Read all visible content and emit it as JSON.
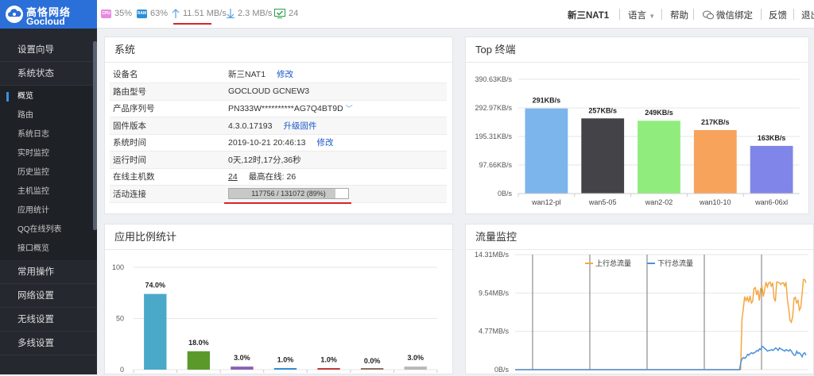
{
  "brand": {
    "title_cn": "高恪网络",
    "title_en": "Gocloud"
  },
  "status": {
    "cpu_icon": "CPU",
    "cpu": "35%",
    "ram_icon": "RAM",
    "ram": "63%",
    "upload": "11.51 MB/s",
    "download": "2.3 MB/s",
    "connections": "24"
  },
  "header": {
    "device": "新三NAT1",
    "language": "语言",
    "help": "帮助",
    "wechat": "微信绑定",
    "feedback": "反馈",
    "exit": "退出"
  },
  "sidebar": {
    "top_items": [
      "设置向导",
      "系统状态"
    ],
    "sub_items": [
      "概览",
      "路由",
      "系统日志",
      "实时监控",
      "历史监控",
      "主机监控",
      "应用统计",
      "QQ在线列表",
      "接口概览"
    ],
    "bottom_items": [
      "常用操作",
      "网络设置",
      "无线设置",
      "多线设置"
    ]
  },
  "system": {
    "title": "系统",
    "rows": [
      {
        "key": "设备名",
        "value": "新三NAT1",
        "link": "修改"
      },
      {
        "key": "路由型号",
        "value": "GOCLOUD GCNEW3"
      },
      {
        "key": "产品序列号",
        "value": "PN333W**********AG7Q4BT9D"
      },
      {
        "key": "固件版本",
        "value": "4.3.0.17193",
        "link": "升级固件"
      },
      {
        "key": "系统时间",
        "value": "2019-10-21 20:46:13",
        "link": "修改"
      },
      {
        "key": "运行时间",
        "value": "0天,12时,17分,36秒"
      },
      {
        "key": "在线主机数",
        "value": "24",
        "extra": "最高在线: 26"
      }
    ],
    "active_conn_key": "活动连接",
    "active_conn_text": "117756 / 131072 (89%)",
    "active_conn_fraction": 0.89
  },
  "top": {
    "title": "Top 终端",
    "chart_data": {
      "type": "bar",
      "categories": [
        "wan12-pl",
        "wan5-05",
        "wan2-02",
        "wan10-10",
        "wan6-06xl"
      ],
      "values": [
        291,
        257,
        249,
        217,
        163
      ],
      "value_labels": [
        "291KB/s",
        "257KB/s",
        "249KB/s",
        "217KB/s",
        "163KB/s"
      ],
      "colors": [
        "#7cb5ec",
        "#434348",
        "#90ed7d",
        "#f7a35c",
        "#8085e9"
      ],
      "ylim": [
        0,
        390.63
      ],
      "yticks": [
        0,
        97.66,
        195.31,
        292.97,
        390.63
      ],
      "ytick_labels": [
        "0B/s",
        "97.66KB/s",
        "195.31KB/s",
        "292.97KB/s",
        "390.63KB/s"
      ],
      "grid": true
    }
  },
  "app": {
    "title": "应用比例统计",
    "chart_data": {
      "type": "bar",
      "values": [
        74.0,
        18.0,
        3.0,
        1.0,
        1.0,
        0.0,
        3.0
      ],
      "value_labels": [
        "74.0%",
        "18.0%",
        "3.0%",
        "1.0%",
        "1.0%",
        "0.0%",
        "3.0%"
      ],
      "colors": [
        "#4aa9c9",
        "#5b9a2a",
        "#8a5fb3",
        "#2f8fd6",
        "#c23a3a",
        "#8d6e63",
        "#b8b8b8"
      ],
      "ylim": [
        0,
        100
      ],
      "yticks": [
        0,
        50,
        100
      ],
      "grid": true
    }
  },
  "traffic": {
    "title": "流量监控",
    "chart_data": {
      "type": "line",
      "series": [
        {
          "name": "上行总流量",
          "color": "#f5a742",
          "values": [
            0,
            0,
            0,
            0,
            0,
            0,
            0,
            0,
            0,
            0,
            0,
            0,
            0,
            0,
            0,
            0,
            0,
            0,
            0,
            0,
            0,
            0,
            0,
            0,
            0,
            0,
            0,
            0,
            0,
            0,
            0,
            0,
            0,
            0,
            0,
            0,
            0,
            0,
            0,
            0,
            0,
            0,
            0,
            0,
            0,
            0,
            0,
            0,
            0,
            0,
            0,
            0,
            0,
            0,
            0,
            0,
            0,
            0,
            0,
            0,
            0,
            0,
            0,
            0,
            0,
            0,
            0,
            0,
            0,
            0,
            0,
            0,
            0,
            0,
            0,
            0,
            0,
            0,
            0,
            0,
            0,
            0,
            0,
            0,
            0,
            0,
            0,
            0,
            0,
            0,
            0,
            0,
            0,
            0,
            0,
            0,
            0,
            0,
            0,
            0,
            0,
            0,
            0,
            0,
            0,
            0,
            0,
            0,
            0,
            0,
            0,
            0,
            0,
            0,
            0,
            0,
            0,
            0,
            0,
            0,
            0,
            0,
            0,
            0,
            0,
            0,
            0,
            0,
            0,
            0,
            0,
            0,
            0,
            0,
            0,
            0,
            0,
            0,
            0,
            0,
            0,
            0,
            0,
            0,
            0,
            0,
            0,
            0,
            0,
            0,
            0,
            0,
            0,
            0,
            0,
            0,
            0,
            0,
            0,
            0,
            0,
            0,
            0,
            0,
            0,
            0,
            0,
            0,
            0,
            0,
            6.3,
            7.6,
            9.1,
            8.6,
            9.0,
            8.4,
            9.2,
            8.3,
            8.5,
            10.1,
            10.2,
            9.3,
            9.9,
            8.6,
            10.1,
            10.3,
            9.1,
            10.0,
            10.9,
            10.3,
            10.8,
            10.9,
            10.4,
            10.8,
            8.9,
            8.5,
            10.9,
            10.9,
            10.8,
            10.6,
            10.8,
            10.8,
            10.4,
            10.9,
            8.8,
            7.6,
            6.1,
            5.9,
            6.6,
            8.9,
            9.0,
            8.3,
            8.6,
            7.4,
            7.7,
            9.4,
            11.2,
            11.2,
            10.8
          ]
        },
        {
          "name": "下行总流量",
          "color": "#4a90d9",
          "values": [
            0,
            0,
            0,
            0,
            0,
            0,
            0,
            0,
            0,
            0,
            0,
            0,
            0,
            0,
            0,
            0,
            0,
            0,
            0,
            0,
            0,
            0,
            0,
            0,
            0,
            0,
            0,
            0,
            0,
            0,
            0,
            0,
            0,
            0,
            0,
            0,
            0,
            0,
            0,
            0,
            0,
            0,
            0,
            0,
            0,
            0,
            0,
            0,
            0,
            0,
            0,
            0,
            0,
            0,
            0,
            0,
            0,
            0,
            0,
            0,
            0,
            0,
            0,
            0,
            0,
            0,
            0,
            0,
            0,
            0,
            0,
            0,
            0,
            0,
            0,
            0,
            0,
            0,
            0,
            0,
            0,
            0,
            0,
            0,
            0,
            0,
            0,
            0,
            0,
            0,
            0,
            0,
            0,
            0,
            0,
            0,
            0,
            0,
            0,
            0,
            0,
            0,
            0,
            0,
            0,
            0,
            0,
            0,
            0,
            0,
            0,
            0,
            0,
            0,
            0,
            0,
            0,
            0,
            0,
            0,
            0,
            0,
            0,
            0,
            0,
            0,
            0,
            0,
            0,
            0,
            0,
            0,
            0,
            0,
            0,
            0,
            0,
            0,
            0,
            0,
            0,
            0,
            0,
            0,
            0,
            0,
            0,
            0,
            0,
            0,
            0,
            0,
            0,
            0,
            0,
            0,
            0,
            0,
            0,
            0,
            0,
            0,
            0,
            0,
            0,
            0,
            0,
            0,
            0,
            0,
            1.0,
            1.4,
            1.5,
            1.4,
            1.6,
            1.9,
            1.8,
            2.0,
            2.1,
            2.0,
            2.1,
            2.2,
            2.4,
            2.3,
            2.6,
            2.5,
            2.9,
            2.8,
            2.6,
            2.5,
            2.3,
            2.4,
            2.4,
            2.5,
            2.4,
            2.5,
            2.7,
            2.6,
            2.4,
            2.7,
            2.6,
            2.5,
            2.4,
            2.3,
            2.5,
            2.4,
            2.3,
            2.5,
            2.3,
            2.0,
            1.8,
            1.8,
            2.3,
            2.0,
            2.1,
            1.9,
            1.6,
            2.0,
            2.1,
            1.8
          ]
        }
      ],
      "ylim": [
        0,
        14.31
      ],
      "yticks": [
        0,
        4.77,
        9.54,
        14.31
      ],
      "ytick_labels": [
        "0B/s",
        "4.77MB/s",
        "9.54MB/s",
        "14.31MB/s"
      ],
      "grid": true
    }
  }
}
